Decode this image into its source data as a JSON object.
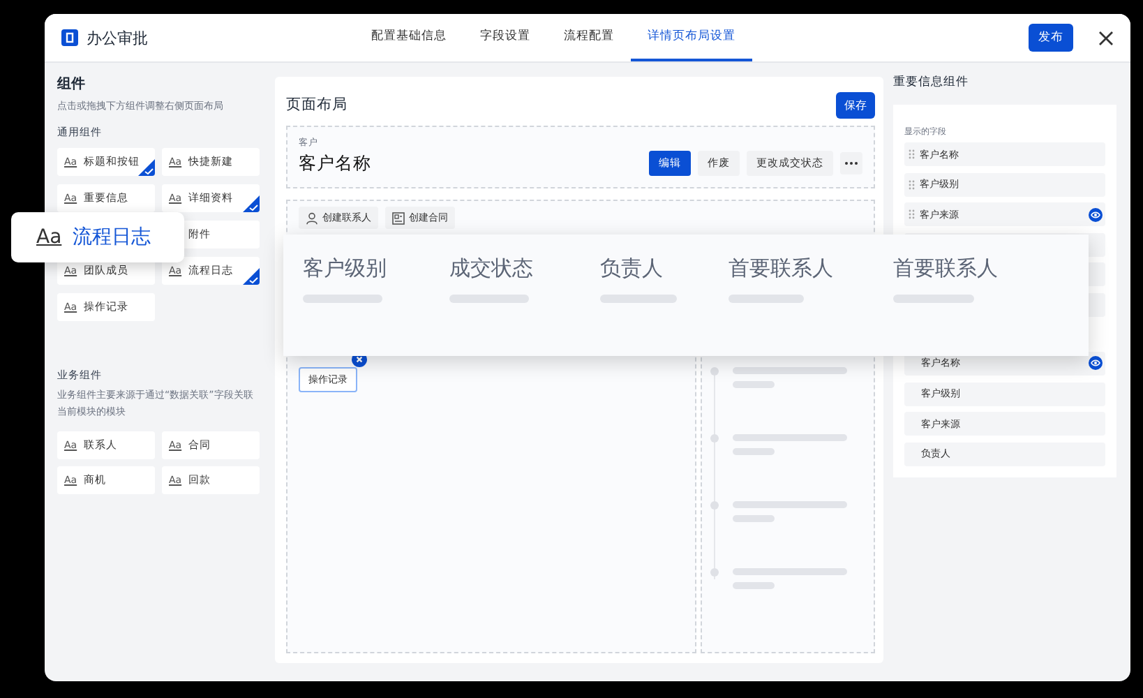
{
  "window": {
    "title": "办公审批"
  },
  "tabs": [
    {
      "label": "配置基础信息",
      "selected": false
    },
    {
      "label": "字段设置",
      "selected": false
    },
    {
      "label": "流程配置",
      "selected": false
    },
    {
      "label": "详情页布局设置",
      "selected": true
    }
  ],
  "publish_button": "发布",
  "components": {
    "title": "组件",
    "hint": "点击或拖拽下方组件调整右侧页面布局",
    "general": {
      "title": "通用组件",
      "items": [
        {
          "kind": "tile",
          "icon": "Aa",
          "label": "标题和按钮",
          "checked": true
        },
        {
          "kind": "tile",
          "icon": "Aa",
          "label": "快捷新建",
          "checked": false
        },
        {
          "kind": "tile",
          "icon": "Aa",
          "label": "重要信息",
          "checked": false
        },
        {
          "kind": "tile",
          "icon": "Aa",
          "label": "详细资料",
          "checked": true
        },
        {
          "kind": "covered"
        },
        {
          "kind": "tile",
          "label": "附件",
          "checked": false
        },
        {
          "kind": "tile",
          "icon": "Aa",
          "label": "团队成员",
          "checked": false
        },
        {
          "kind": "tile",
          "icon": "Aa",
          "label": "流程日志",
          "checked": true
        },
        {
          "kind": "tile",
          "icon": "Aa",
          "label": "操作记录",
          "checked": false
        }
      ]
    },
    "business": {
      "title": "业务组件",
      "hint": "业务组件主要来源于通过“数据关联”字段关联当前模块的模块",
      "items": [
        {
          "icon": "Aa",
          "label": "联系人"
        },
        {
          "icon": "Aa",
          "label": "合同"
        },
        {
          "icon": "Aa",
          "label": "商机"
        },
        {
          "icon": "Aa",
          "label": "回款"
        }
      ]
    }
  },
  "dragging": {
    "icon": "Aa",
    "label": "流程日志"
  },
  "layout": {
    "title": "页面布局",
    "save_button": "保存",
    "record": {
      "type_label": "客户",
      "name": "客户名称",
      "actions": [
        {
          "label": "编辑",
          "primary": true
        },
        {
          "label": "作废",
          "primary": false
        },
        {
          "label": "更改成交状态",
          "primary": false
        }
      ]
    },
    "quick_actions": [
      {
        "kind": "person",
        "label": "创建联系人"
      },
      {
        "kind": "contract",
        "label": "创建合同"
      }
    ],
    "placed_tag": {
      "label": "操作记录",
      "removable": true
    }
  },
  "fields_card": {
    "fields": [
      "客户级别",
      "成交状态",
      "负责人",
      "首要联系人",
      "首要联系人"
    ]
  },
  "important": {
    "title": "重要信息组件",
    "shown_label": "显示的字段",
    "shown": [
      {
        "kind": "field",
        "label": "客户名称",
        "eye": false
      },
      {
        "kind": "field",
        "label": "客户级别",
        "eye": false
      },
      {
        "kind": "field",
        "label": "客户来源",
        "eye": true
      },
      {
        "kind": "covered"
      },
      {
        "kind": "covered"
      },
      {
        "kind": "covered"
      }
    ],
    "others": [
      {
        "label": "客户名称",
        "eye": true
      },
      {
        "label": "客户级别",
        "eye": false
      },
      {
        "label": "客户来源",
        "eye": false
      },
      {
        "label": "负责人",
        "eye": false
      }
    ]
  }
}
